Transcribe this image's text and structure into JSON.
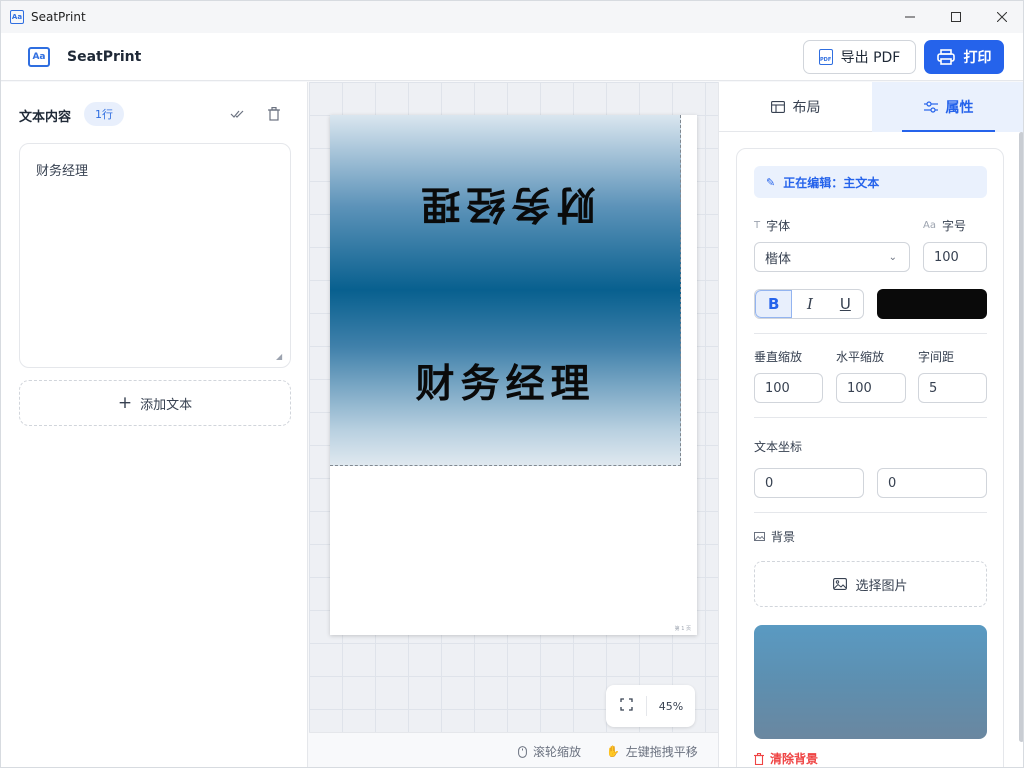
{
  "window": {
    "title": "SeatPrint"
  },
  "header": {
    "brand": "SeatPrint",
    "export_label": "导出 PDF",
    "print_label": "打印"
  },
  "left": {
    "section_title": "文本内容",
    "line_badge": "1行",
    "text_value": "财务经理",
    "add_text_label": "添加文本"
  },
  "canvas": {
    "label_text_top": "财务经理",
    "label_text_bottom": "财务经理",
    "page_number": "第 1 页",
    "zoom": "45%"
  },
  "status": {
    "wheel_zoom": "滚轮缩放",
    "drag_pan": "左键拖拽平移"
  },
  "right": {
    "tab_layout": "布局",
    "tab_properties": "属性",
    "editing": "正在编辑：主文本",
    "font_label": "字体",
    "font_value": "楷体",
    "size_label": "字号",
    "size_value": "100",
    "bold": "B",
    "italic": "I",
    "underline": "U",
    "text_color": "#0a0a0a",
    "vscale_label": "垂直缩放",
    "vscale_value": "100",
    "hscale_label": "水平缩放",
    "hscale_value": "100",
    "spacing_label": "字间距",
    "spacing_value": "5",
    "coords_label": "文本坐标",
    "coord_x": "0",
    "coord_y": "0",
    "background_label": "背景",
    "choose_image_label": "选择图片",
    "clear_bg_label": "清除背景"
  },
  "colors": {
    "accent": "#2563eb",
    "danger": "#ef4444"
  }
}
